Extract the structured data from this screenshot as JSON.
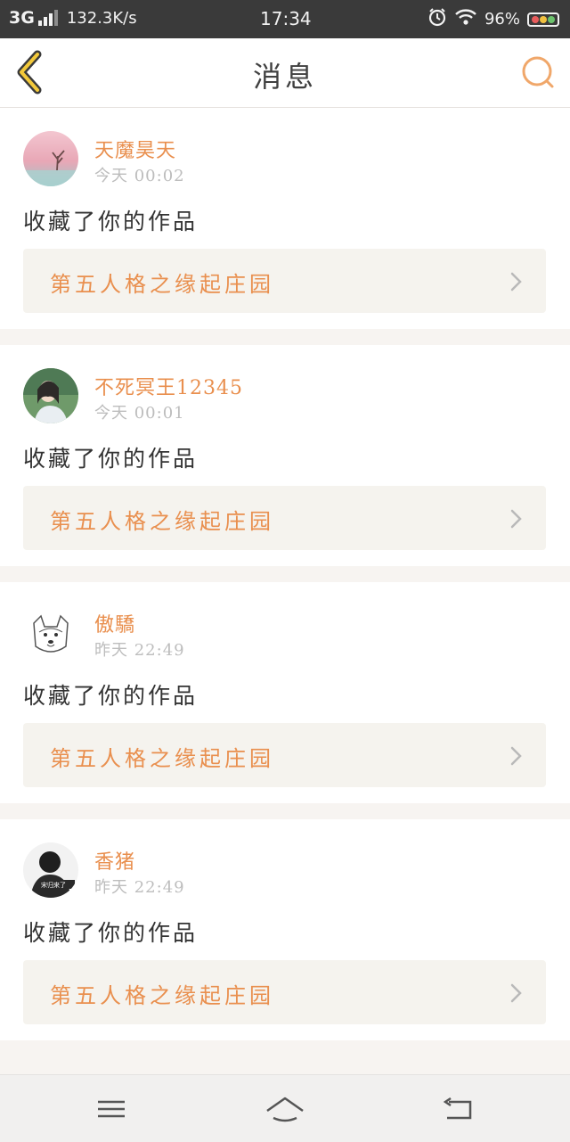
{
  "status_bar": {
    "network": "3G",
    "speed": "132.3K/s",
    "time": "17:34",
    "battery": "96%"
  },
  "header": {
    "title": "消息",
    "accent_color": "#e98f4e"
  },
  "messages": [
    {
      "user": "天魔昊天",
      "time": "今天 00:02",
      "action": "收藏了你的作品",
      "work": "第五人格之缘起庄园",
      "avatar": "pink-sky-tree"
    },
    {
      "user": "不死冥王12345",
      "time": "今天 00:01",
      "action": "收藏了你的作品",
      "work": "第五人格之缘起庄园",
      "avatar": "girl-portrait"
    },
    {
      "user": "傲驕",
      "time": "昨天 22:49",
      "action": "收藏了你的作品",
      "work": "第五人格之缘起庄园",
      "avatar": "doge-sketch"
    },
    {
      "user": "香猪",
      "time": "昨天 22:49",
      "action": "收藏了你的作品",
      "work": "第五人格之缘起庄园",
      "avatar": "dark-silhouette",
      "avatar_caption": "宋归来了"
    }
  ],
  "icons": {
    "back": "chevron-left-icon",
    "search": "search-icon",
    "nav_menu": "menu-icon",
    "nav_home": "home-icon",
    "nav_back": "return-icon"
  }
}
